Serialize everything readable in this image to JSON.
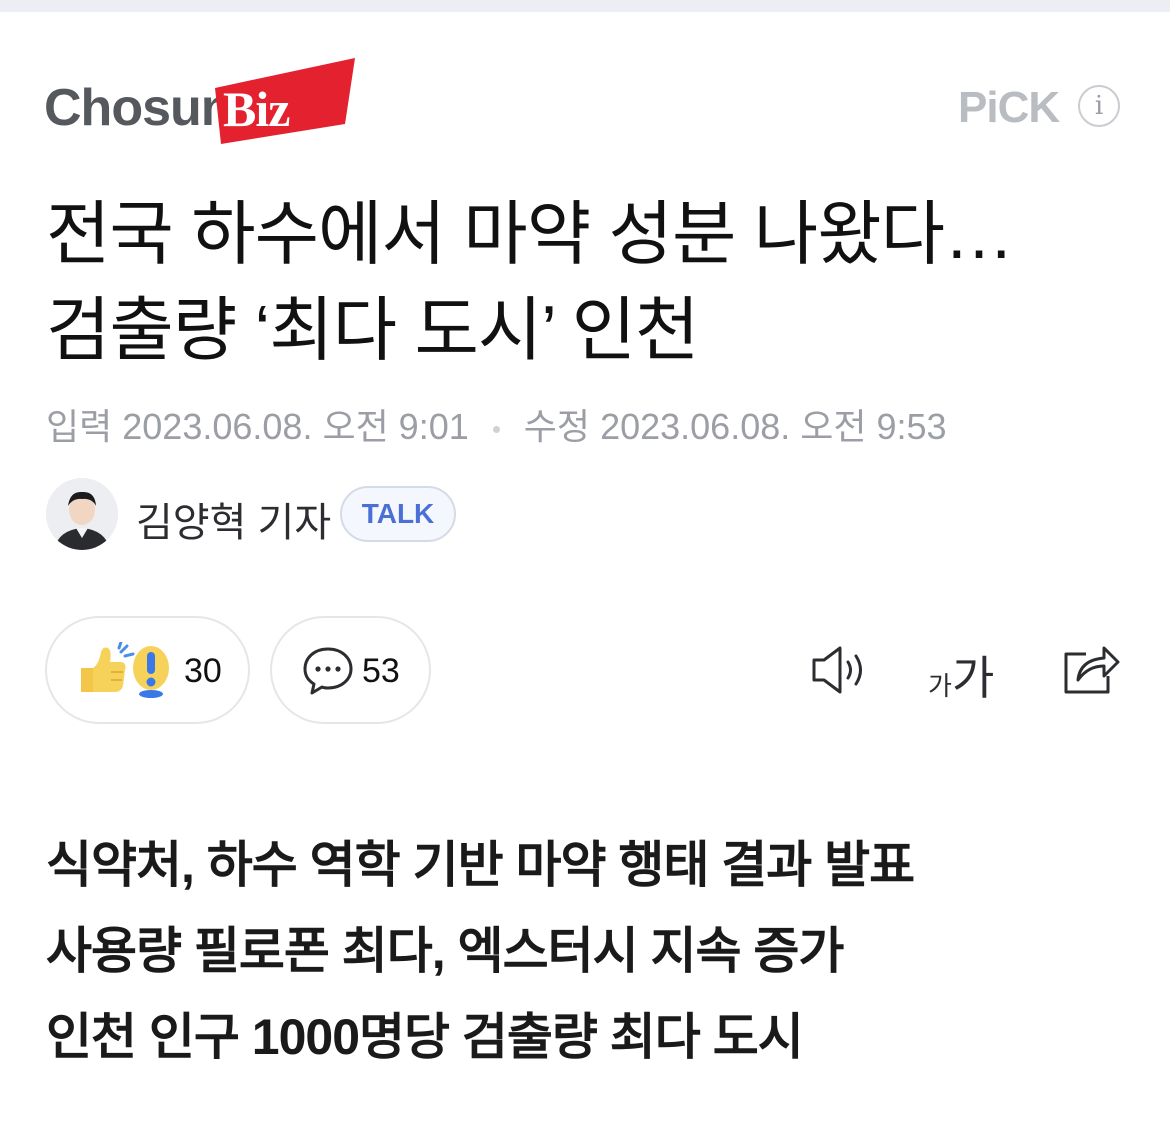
{
  "publisher": {
    "logo_text": "Chosun",
    "logo_highlight": "Biz",
    "brand_color": "#e3212f"
  },
  "pick": {
    "label": "PiCK",
    "info_icon": "info-icon"
  },
  "article": {
    "headline_line1": "전국 하수에서 마약 성분 나왔다…",
    "headline_line2": "검출량 ‘최다 도시’ 인천",
    "input_label": "입력",
    "input_date": "2023.06.08. 오전 9:01",
    "modified_label": "수정",
    "modified_date": "2023.06.08. 오전 9:53"
  },
  "reporter": {
    "name": "김양혁 기자",
    "talk_label": "TALK"
  },
  "actions": {
    "reaction_count": "30",
    "comment_count": "53",
    "font_small": "가",
    "font_big": "가",
    "icons": [
      "reaction-emoji-icon",
      "comment-bubble-icon",
      "speaker-icon",
      "font-size-icon",
      "share-icon"
    ]
  },
  "subheads": [
    "식약처, 하수 역학 기반 마약 행태 결과 발표",
    "사용량 필로폰 최다, 엑스터시 지속 증가",
    "인천 인구 1000명당 검출량 최다 도시"
  ]
}
